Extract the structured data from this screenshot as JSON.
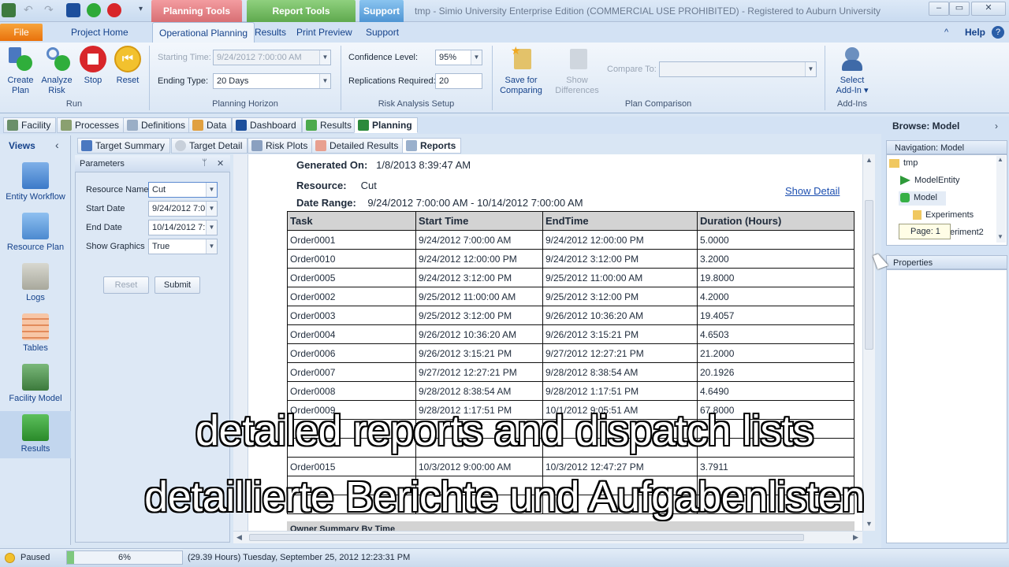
{
  "titlebar": {
    "context_tabs": [
      "Planning Tools",
      "Report Tools",
      "Support"
    ],
    "window_title": "tmp - Simio University Enterprise Edition (COMMERCIAL USE PROHIBITED) - Registered to Auburn University",
    "min": "–",
    "max": "▭",
    "close": "✕"
  },
  "ribbon_tabs": {
    "file": "File",
    "tabs": [
      "Project Home",
      "Operational Planning",
      "Results",
      "Print Preview",
      "Support"
    ],
    "help": "Help",
    "caret_up": "^"
  },
  "ribbon": {
    "run": {
      "label": "Run",
      "buttons": [
        {
          "label": "Create\nPlan",
          "l1": "Create",
          "l2": "Plan"
        },
        {
          "l1": "Analyze",
          "l2": "Risk"
        },
        {
          "l1": "Stop",
          "l2": ""
        },
        {
          "l1": "Reset",
          "l2": ""
        }
      ]
    },
    "planning_horizon": {
      "label": "Planning Horizon",
      "starting_time_label": "Starting Time:",
      "starting_time_value": "9/24/2012 7:00:00 AM",
      "ending_type_label": "Ending Type:",
      "ending_type_value": "20 Days"
    },
    "risk": {
      "label": "Risk Analysis Setup",
      "confidence_label": "Confidence Level:",
      "confidence_value": "95%",
      "replications_label": "Replications Required:",
      "replications_value": "20"
    },
    "comparison": {
      "label": "Plan Comparison",
      "save_l1": "Save for",
      "save_l2": "Comparing",
      "show_l1": "Show",
      "show_l2": "Differences",
      "compare_label": "Compare To:"
    },
    "addins": {
      "label": "Add-Ins",
      "select_l1": "Select",
      "select_l2": "Add-In ▾"
    }
  },
  "main_tabs": [
    "Facility",
    "Processes",
    "Definitions",
    "Data",
    "Dashboard",
    "Results",
    "Planning"
  ],
  "views": {
    "title": "Views",
    "collapse": "‹",
    "items": [
      "Entity Workflow",
      "Resource Plan",
      "Logs",
      "Tables",
      "Facility Model",
      "Results"
    ]
  },
  "sub_tabs": [
    "Target Summary",
    "Target Detail",
    "Risk Plots",
    "Detailed Results",
    "Reports"
  ],
  "parameters": {
    "title": "Parameters",
    "pin": "ᛘ",
    "close": "✕",
    "fields": [
      {
        "label": "Resource Name",
        "value": "Cut"
      },
      {
        "label": "Start Date",
        "value": "9/24/2012 7:0"
      },
      {
        "label": "End Date",
        "value": "10/14/2012 7:"
      },
      {
        "label": "Show Graphics",
        "value": "True"
      }
    ],
    "reset": "Reset",
    "submit": "Submit"
  },
  "report": {
    "generated_label": "Generated On:",
    "generated_value": "1/8/2013 8:39:47 AM",
    "resource_label": "Resource:",
    "resource_value": "Cut",
    "daterange_label": "Date Range:",
    "daterange_value": "9/24/2012 7:00:00 AM - 10/14/2012 7:00:00 AM",
    "show_detail": "Show Detail",
    "columns": [
      "Task",
      "Start Time",
      "EndTime",
      "Duration (Hours)"
    ],
    "rows": [
      [
        "Order0001",
        "9/24/2012 7:00:00 AM",
        "9/24/2012 12:00:00 PM",
        "5.0000"
      ],
      [
        "Order0010",
        "9/24/2012 12:00:00 PM",
        "9/24/2012 3:12:00 PM",
        "3.2000"
      ],
      [
        "Order0005",
        "9/24/2012 3:12:00 PM",
        "9/25/2012 11:00:00 AM",
        "19.8000"
      ],
      [
        "Order0002",
        "9/25/2012 11:00:00 AM",
        "9/25/2012 3:12:00 PM",
        "4.2000"
      ],
      [
        "Order0003",
        "9/25/2012 3:12:00 PM",
        "9/26/2012 10:36:20 AM",
        "19.4057"
      ],
      [
        "Order0004",
        "9/26/2012 10:36:20 AM",
        "9/26/2012 3:15:21 PM",
        "4.6503"
      ],
      [
        "Order0006",
        "9/26/2012 3:15:21 PM",
        "9/27/2012 12:27:21 PM",
        "21.2000"
      ],
      [
        "Order0007",
        "9/27/2012 12:27:21 PM",
        "9/28/2012 8:38:54 AM",
        "20.1926"
      ],
      [
        "Order0008",
        "9/28/2012 8:38:54 AM",
        "9/28/2012 1:17:51 PM",
        "4.6490"
      ],
      [
        "Order0009",
        "9/28/2012 1:17:51 PM",
        "10/1/2012 9:05:51 AM",
        "67.8000"
      ],
      [
        "",
        "",
        "",
        ""
      ],
      [
        "",
        "",
        "",
        ""
      ],
      [
        "Order0015",
        "10/3/2012 9:00:00 AM",
        "10/3/2012 12:47:27 PM",
        "3.7911"
      ],
      [
        "",
        "",
        "",
        ""
      ],
      [
        "",
        "",
        "",
        ""
      ]
    ],
    "footer": "Owner Summary By Time"
  },
  "right_panel": {
    "browse_title": "Browse: Model",
    "nav_title": "Navigation: Model",
    "tree": [
      "tmp",
      "ModelEntity",
      "Model",
      "Experiments",
      "Experiment2"
    ],
    "tooltip": "Page: 1",
    "properties_title": "Properties"
  },
  "status": {
    "state": "Paused",
    "progress_text": "6%",
    "progress_fraction": 0.06,
    "time": "(29.39 Hours) Tuesday, September 25, 2012 12:23:31 PM"
  },
  "subtitles": {
    "en": "detailed reports and dispatch lists",
    "de": "detaillierte Berichte und Aufgabenlisten"
  },
  "colors": {
    "planning_tools": "#e07a7f",
    "report_tools": "#6fb55e",
    "support": "#5fa6e0",
    "file": "#ef8a1e"
  }
}
